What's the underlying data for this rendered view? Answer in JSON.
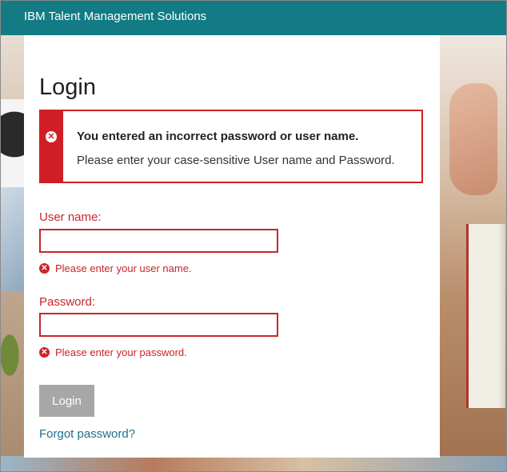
{
  "header": {
    "title": "IBM Talent Management Solutions"
  },
  "login": {
    "title": "Login",
    "error": {
      "heading": "You entered an incorrect password or user name.",
      "message": "Please enter your case-sensitive User name and Password."
    },
    "username": {
      "label": "User name:",
      "value": "",
      "error": "Please enter your user name."
    },
    "password": {
      "label": "Password:",
      "value": "",
      "error": "Please enter your password."
    },
    "button_label": "Login",
    "forgot_link": "Forgot password?"
  },
  "colors": {
    "header": "#127b84",
    "error": "#c8252a",
    "button": "#a7a7a7",
    "link": "#1f6f8e"
  },
  "icons": {
    "error": "error-circle-x-icon"
  }
}
